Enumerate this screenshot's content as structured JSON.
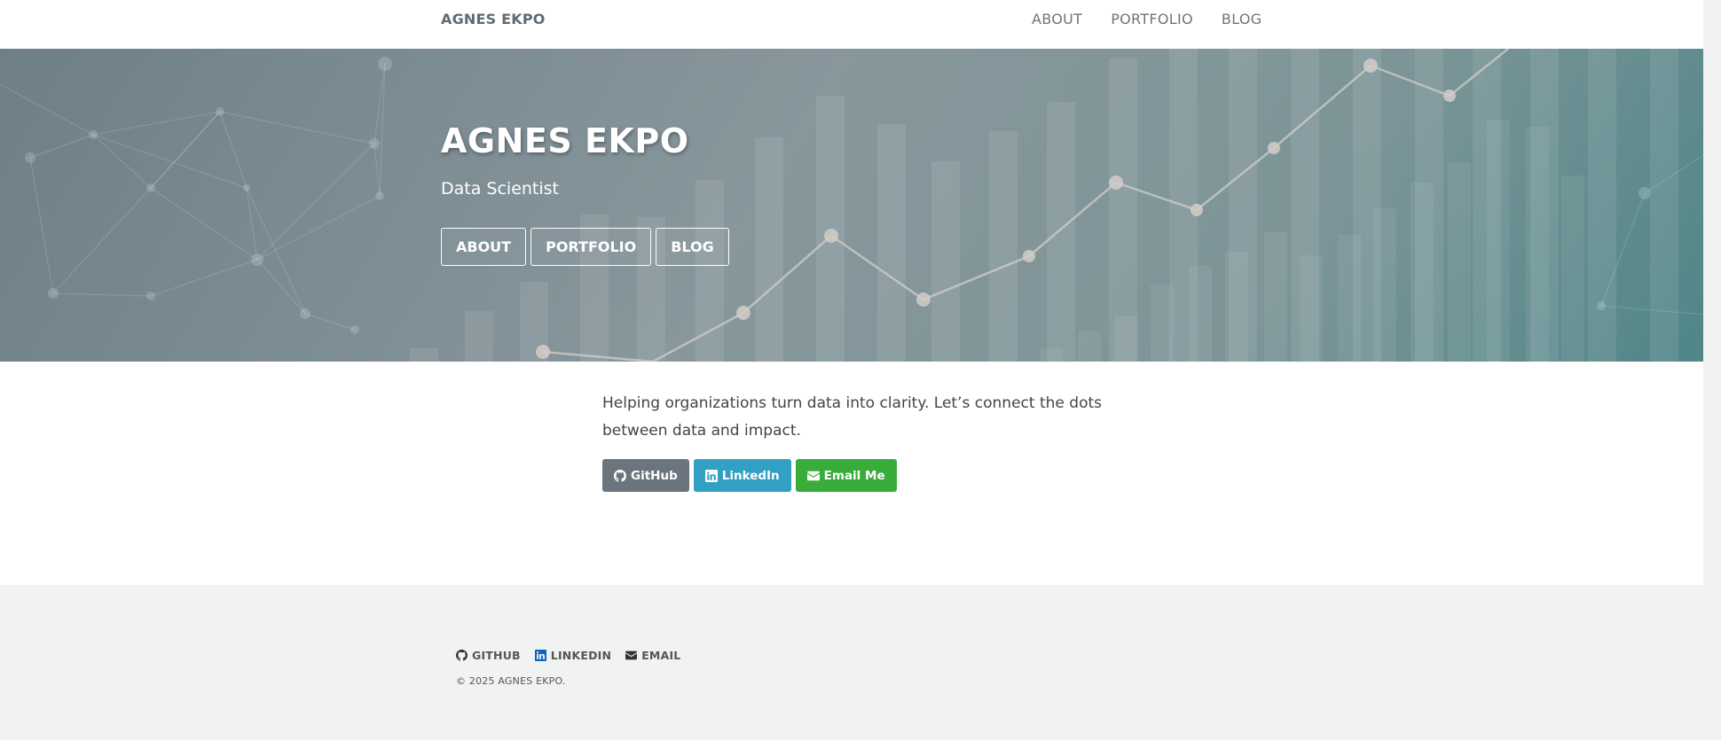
{
  "nav": {
    "brand": "AGNES EKPO",
    "links": [
      "ABOUT",
      "PORTFOLIO",
      "BLOG"
    ]
  },
  "hero": {
    "title": "AGNES EKPO",
    "subtitle": "Data Scientist",
    "buttons": [
      "ABOUT",
      "PORTFOLIO",
      "BLOG"
    ]
  },
  "intro": {
    "text": "Helping organizations turn data into clarity. Let’s connect the dots between data and impact."
  },
  "social_buttons": {
    "github": "GitHub",
    "linkedin": "LinkedIn",
    "email": "Email Me"
  },
  "footer": {
    "links": [
      "GITHUB",
      "LINKEDIN",
      "EMAIL"
    ],
    "copyright": "© 2025 AGNES EKPO."
  },
  "colors": {
    "github_button": "#6c757d",
    "linkedin_button": "#31a0c2",
    "email_button": "#3aac3a",
    "linkedin_icon": "#0a66c2"
  },
  "icons": {
    "github": "github-icon",
    "linkedin": "linkedin-icon",
    "email": "envelope-icon"
  }
}
